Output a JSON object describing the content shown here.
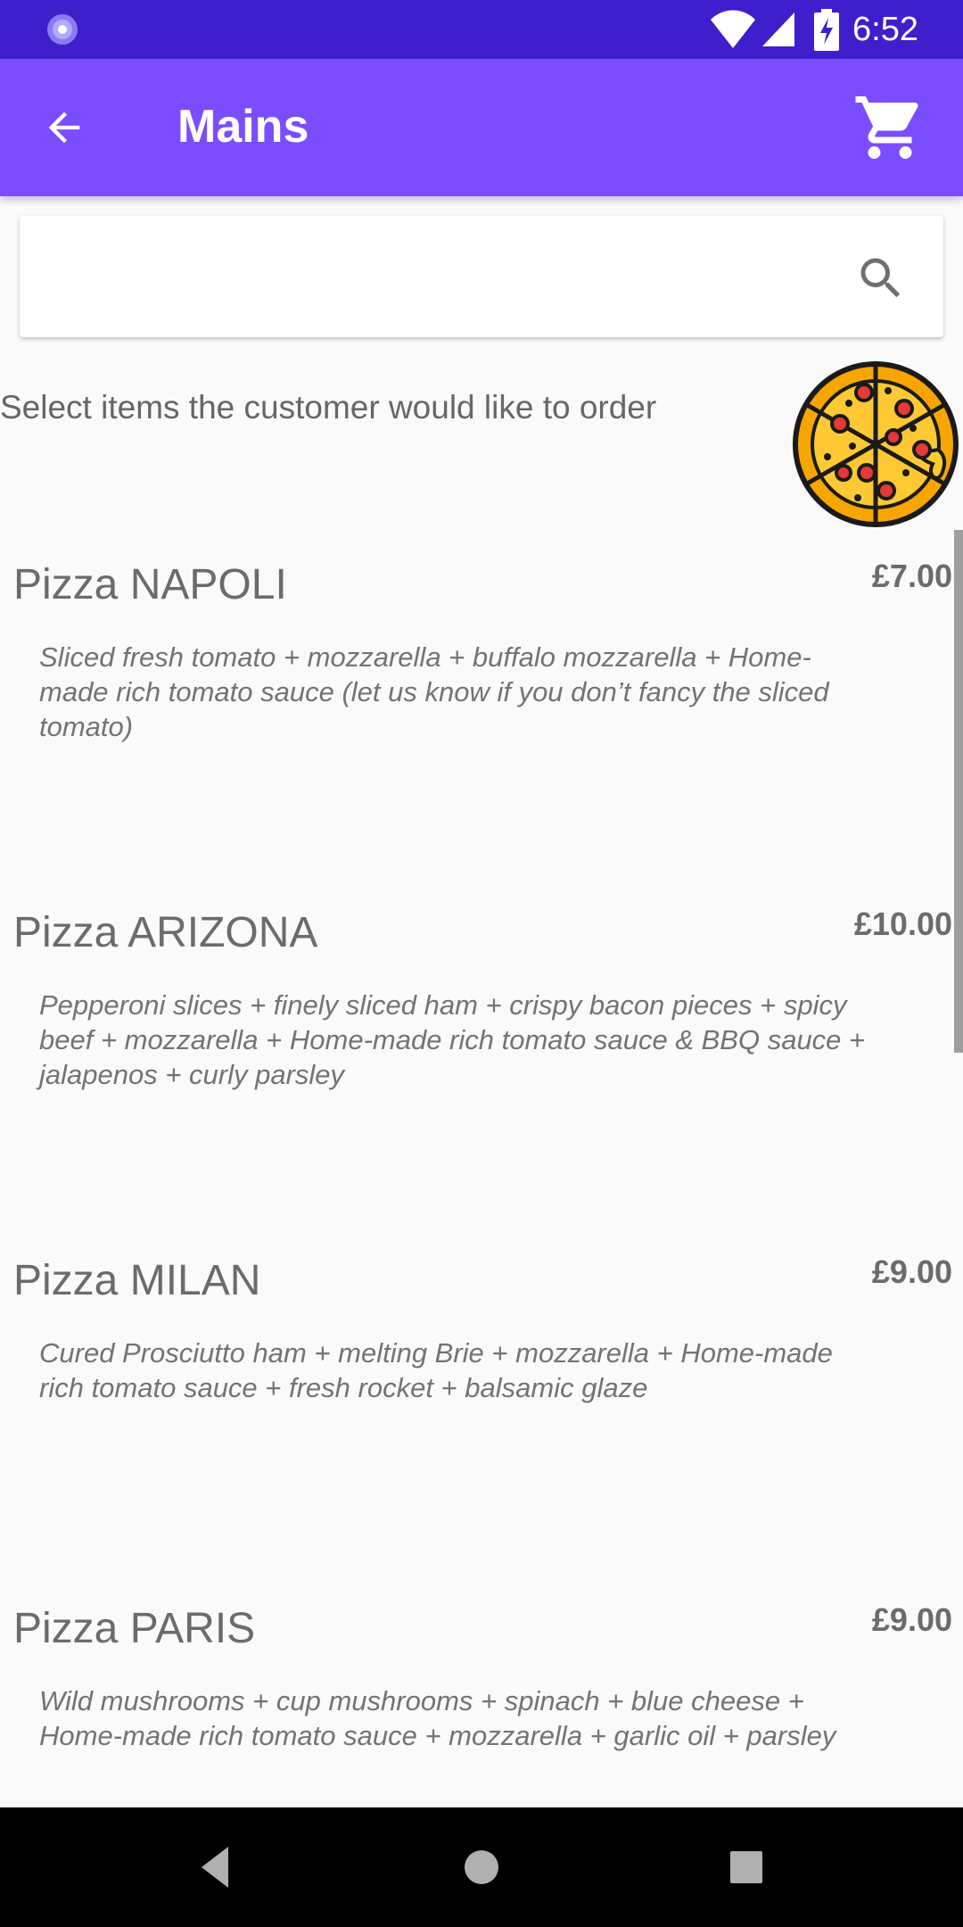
{
  "status_bar": {
    "time": "6:52",
    "icons": [
      "notification-icon",
      "wifi-icon",
      "signal-icon",
      "battery-charging-icon"
    ]
  },
  "app_bar": {
    "title": "Mains",
    "back_icon": "arrow-back-icon",
    "cart_icon": "shopping-cart-icon"
  },
  "search": {
    "value": "",
    "placeholder": "",
    "icon": "search-icon"
  },
  "instruction": "Select items the customer would like to order",
  "illustration": "pizza-icon",
  "menu_items": [
    {
      "name": "Pizza NAPOLI",
      "price": "£7.00",
      "description": "Sliced fresh tomato + mozzarella + buffalo mozzarella + Home-made rich tomato sauce (let us know if you don’t fancy the sliced tomato)"
    },
    {
      "name": "Pizza ARIZONA",
      "price": "£10.00",
      "description": "Pepperoni slices + finely sliced ham + crispy bacon pieces + spicy beef + mozzarella + Home-made rich tomato sauce & BBQ sauce + jalapenos + curly parsley"
    },
    {
      "name": "Pizza MILAN",
      "price": "£9.00",
      "description": "Cured Prosciutto ham + melting Brie + mozzarella + Home-made rich tomato sauce + fresh rocket + balsamic glaze"
    },
    {
      "name": "Pizza PARIS",
      "price": "£9.00",
      "description": "Wild mushrooms + cup mushrooms + spinach + blue cheese + Home-made rich tomato sauce + mozzarella + garlic oil + parsley"
    }
  ],
  "navigation_bar": {
    "icons": [
      "nav-back-icon",
      "nav-home-icon",
      "nav-recents-icon"
    ]
  },
  "colors": {
    "status_bar": "#3f1fcb",
    "app_bar": "#7c4dff",
    "background": "#fafafa",
    "text_primary": "#6b6b6b",
    "pizza_crust": "#f7a600",
    "pizza_cheese": "#ffc933",
    "pepperoni": "#e53935"
  }
}
